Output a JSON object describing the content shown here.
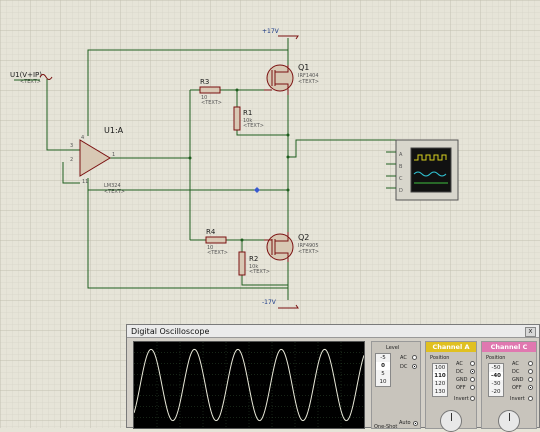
{
  "schematic": {
    "source_label": "U1(V+IP)",
    "source_text": "<TEXT>",
    "power_pos": "+17V",
    "power_neg": "-17V",
    "opamp_ref": "U1:A",
    "opamp_part": "LM324",
    "opamp_text": "<TEXT>",
    "pins": {
      "p4": "4",
      "p3": "3",
      "p2": "2",
      "p1": "1",
      "p11": "11"
    },
    "r3": {
      "ref": "R3",
      "value": "10",
      "text": "<TEXT>"
    },
    "r1": {
      "ref": "R1",
      "value": "10k",
      "text": "<TEXT>"
    },
    "r4": {
      "ref": "R4",
      "value": "10",
      "text": "<TEXT>"
    },
    "r2": {
      "ref": "R2",
      "value": "10k",
      "text": "<TEXT>"
    },
    "q1": {
      "ref": "Q1",
      "part": "IRF1404",
      "text": "<TEXT>"
    },
    "q2": {
      "ref": "Q2",
      "part": "IRF4905",
      "text": "<TEXT>"
    },
    "scope_channels": [
      "A",
      "B",
      "C",
      "D"
    ]
  },
  "oscilloscope": {
    "title": "Digital Oscilloscope",
    "close": "x",
    "trigger": {
      "level_label": "Level",
      "values": [
        "-5",
        "0",
        "5",
        "10"
      ],
      "selected": "0",
      "modes": [
        "AC",
        "DC"
      ],
      "auto": "Auto",
      "one_shot": "One-Shot"
    },
    "channel_a": {
      "header": "Channel A",
      "position_label": "Position",
      "values": [
        "100",
        "110",
        "120",
        "130"
      ],
      "selected": "110",
      "modes": [
        "AC",
        "DC",
        "GND",
        "OFF"
      ],
      "invert": "Invert"
    },
    "channel_c": {
      "header": "Channel C",
      "position_label": "Position",
      "values": [
        "-50",
        "-40",
        "-30",
        "-20"
      ],
      "selected": "-40",
      "modes": [
        "AC",
        "DC",
        "GND",
        "OFF"
      ],
      "invert": "Invert"
    },
    "colors": {
      "trace": "#e8e8d8",
      "grid": "#2f4a2f",
      "channel_a_header": "#e0c020",
      "channel_c_header": "#e078b0"
    },
    "waveform": {
      "cycles": 5.3,
      "amplitude_fraction": 0.55
    }
  }
}
